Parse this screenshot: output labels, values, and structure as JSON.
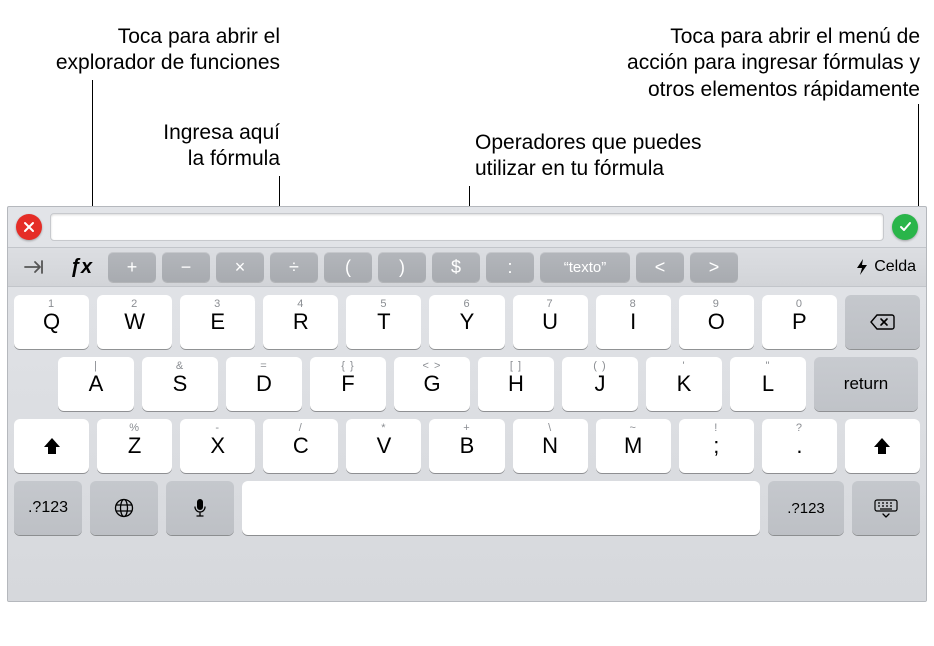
{
  "callouts": {
    "fx_line1": "Toca para abrir el",
    "fx_line2": "explorador de funciones",
    "formula_line1": "Ingresa aquí",
    "formula_line2": "la fórmula",
    "cell_line1": "Toca para abrir el menú de",
    "cell_line2": "acción para ingresar fórmulas y",
    "cell_line3": "otros elementos rápidamente",
    "ops_line1": "Operadores que puedes",
    "ops_line2": "utilizar en tu fórmula"
  },
  "toolbar": {
    "fx_label": "ƒx",
    "cell_label": "Celda",
    "ops": {
      "plus": "+",
      "minus": "−",
      "times": "×",
      "divide": "÷",
      "lparen": "(",
      "rparen": ")",
      "dollar": "$",
      "colon": ":",
      "text": "“texto”",
      "lt": "<",
      "gt": ">"
    }
  },
  "keys": {
    "row1": [
      {
        "main": "Q",
        "sub": "1"
      },
      {
        "main": "W",
        "sub": "2"
      },
      {
        "main": "E",
        "sub": "3"
      },
      {
        "main": "R",
        "sub": "4"
      },
      {
        "main": "T",
        "sub": "5"
      },
      {
        "main": "Y",
        "sub": "6"
      },
      {
        "main": "U",
        "sub": "7"
      },
      {
        "main": "I",
        "sub": "8"
      },
      {
        "main": "O",
        "sub": "9"
      },
      {
        "main": "P",
        "sub": "0"
      }
    ],
    "row2": [
      {
        "main": "A",
        "sub": "|"
      },
      {
        "main": "S",
        "sub": "&"
      },
      {
        "main": "D",
        "sub": "="
      },
      {
        "main": "F",
        "sub": "{ }"
      },
      {
        "main": "G",
        "sub": "< >"
      },
      {
        "main": "H",
        "sub": "[ ]"
      },
      {
        "main": "J",
        "sub": "( )"
      },
      {
        "main": "K",
        "sub": "'"
      },
      {
        "main": "L",
        "sub": "\""
      }
    ],
    "row3": [
      {
        "main": "Z",
        "sub": "%"
      },
      {
        "main": "X",
        "sub": "-"
      },
      {
        "main": "C",
        "sub": "/"
      },
      {
        "main": "V",
        "sub": "*"
      },
      {
        "main": "B",
        "sub": "+"
      },
      {
        "main": "N",
        "sub": "\\"
      },
      {
        "main": "M",
        "sub": "~"
      },
      {
        "main": ";",
        "sub": "!"
      },
      {
        "main": ".",
        "sub": "?"
      }
    ],
    "return": "return",
    "alt": ".?123"
  }
}
